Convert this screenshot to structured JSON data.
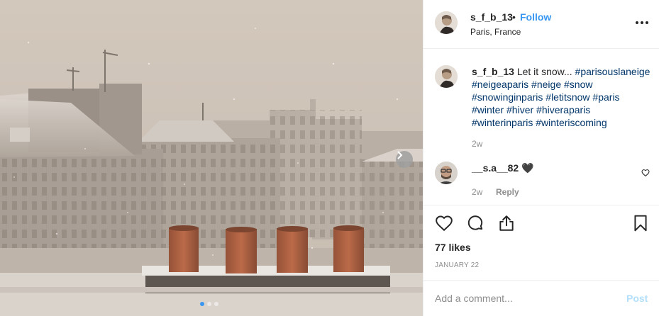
{
  "post": {
    "username": "s_f_b_13",
    "separator": "•",
    "follow_label": "Follow",
    "location": "Paris, France",
    "more_icon": "more-options-icon"
  },
  "caption": {
    "username": "s_f_b_13",
    "text": "Let it snow...",
    "hashtags": "#parisouslaneige #neigeaparis #neige #snow #snowinginparis #letitsnow #paris #winter #hiver #hiveraparis #winterinparis #winteriscoming",
    "time": "2w"
  },
  "comment": {
    "username": "__s.a__82",
    "text": "🖤",
    "time": "2w",
    "reply_label": "Reply"
  },
  "actions": {
    "like_icon": "heart-icon",
    "comment_icon": "comment-icon",
    "share_icon": "share-icon",
    "save_icon": "bookmark-icon"
  },
  "likes_text": "77 likes",
  "date_text": "JANUARY 22",
  "add_comment": {
    "placeholder": "Add a comment...",
    "post_label": "Post"
  },
  "carousel": {
    "slide_count": 3,
    "active_index": 0,
    "next_icon": "chevron-right-icon"
  },
  "colors": {
    "link_blue": "#3897f0",
    "hashtag_blue": "#003569",
    "muted": "#8e8e8e",
    "post_disabled": "#b2dffc"
  }
}
